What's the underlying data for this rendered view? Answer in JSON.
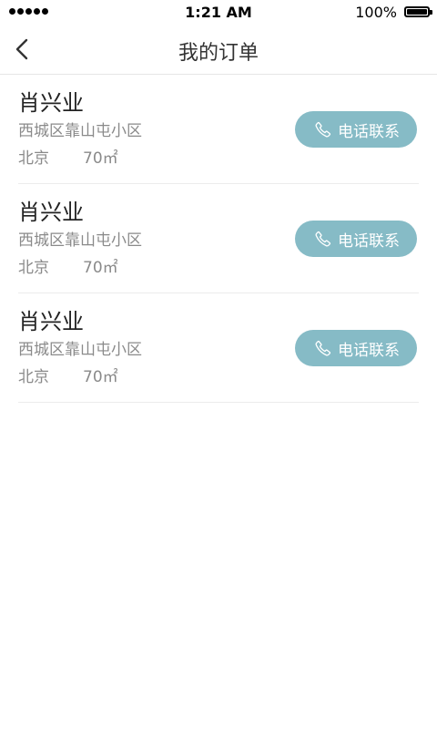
{
  "status_bar": {
    "time": "1:21 AM",
    "battery": "100%",
    "signal_icon": "signal-dots-icon",
    "battery_icon": "battery-icon"
  },
  "nav": {
    "title": "我的订单",
    "back_icon": "chevron-left-icon"
  },
  "orders": [
    {
      "name": "肖兴业",
      "address": "西城区靠山屯小区",
      "city": "北京",
      "area": "70㎡",
      "call_label": "电话联系"
    },
    {
      "name": "肖兴业",
      "address": "西城区靠山屯小区",
      "city": "北京",
      "area": "70㎡",
      "call_label": "电话联系"
    },
    {
      "name": "肖兴业",
      "address": "西城区靠山屯小区",
      "city": "北京",
      "area": "70㎡",
      "call_label": "电话联系"
    }
  ],
  "colors": {
    "accent": "#86bbc6",
    "secondary_text": "#8a8a8a",
    "divider": "#ececec"
  }
}
